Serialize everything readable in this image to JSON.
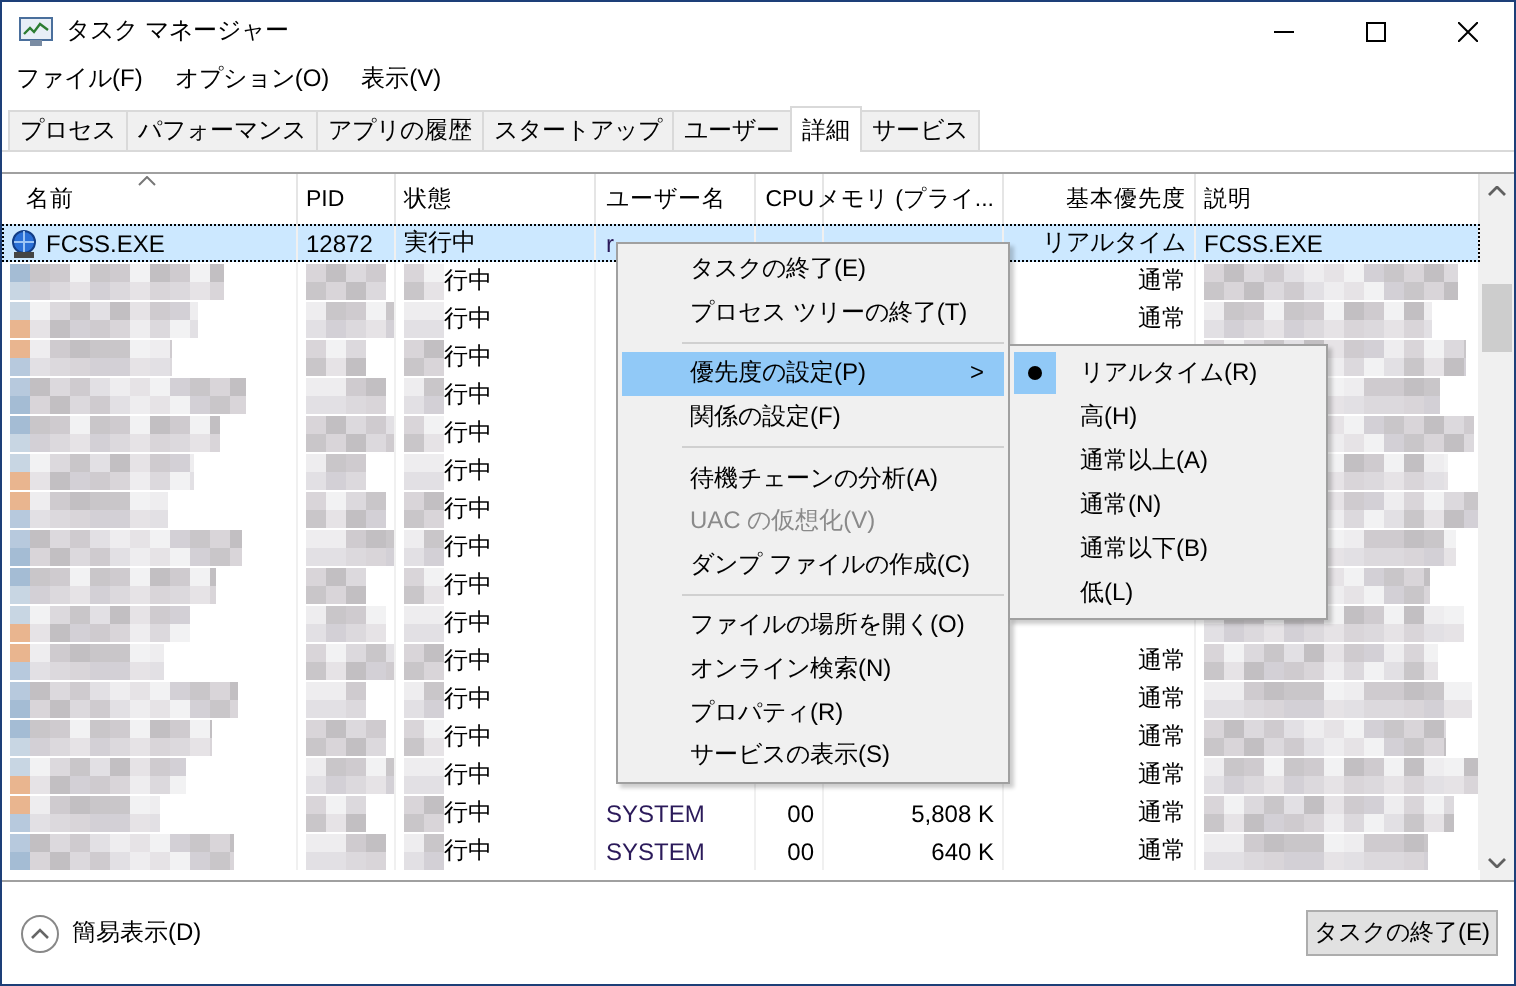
{
  "window": {
    "title": "タスク マネージャー"
  },
  "menubar": [
    "ファイル(F)",
    "オプション(O)",
    "表示(V)"
  ],
  "tabs": [
    {
      "label": "プロセス",
      "selected": false
    },
    {
      "label": "パフォーマンス",
      "selected": false
    },
    {
      "label": "アプリの履歴",
      "selected": false
    },
    {
      "label": "スタートアップ",
      "selected": false
    },
    {
      "label": "ユーザー",
      "selected": false
    },
    {
      "label": "詳細",
      "selected": true
    },
    {
      "label": "サービス",
      "selected": false
    }
  ],
  "table": {
    "columns": [
      "名前",
      "PID",
      "状態",
      "ユーザー名",
      "CPU",
      "メモリ (プライ...",
      "基本優先度",
      "説明"
    ],
    "rows": [
      {
        "name": "FCSS.EXE",
        "pid": "12872",
        "status": "実行中",
        "user": "r",
        "priority": "リアルタイム",
        "description": "FCSS.EXE",
        "selected": true
      },
      {
        "status": "行中",
        "priority": "通常",
        "selected": false
      },
      {
        "status": "行中",
        "priority": "通常",
        "selected": false
      },
      {
        "status": "行中",
        "selected": false
      },
      {
        "status": "行中",
        "selected": false
      },
      {
        "status": "行中",
        "selected": false
      },
      {
        "status": "行中",
        "selected": false
      },
      {
        "status": "行中",
        "selected": false
      },
      {
        "status": "行中",
        "selected": false
      },
      {
        "status": "行中",
        "selected": false
      },
      {
        "status": "行中",
        "selected": false
      },
      {
        "status": "行中",
        "priority": "通常",
        "selected": false
      },
      {
        "status": "行中",
        "priority": "通常",
        "selected": false
      },
      {
        "status": "行中",
        "priority": "通常",
        "selected": false
      },
      {
        "status": "行中",
        "priority": "通常",
        "selected": false
      },
      {
        "status": "行中",
        "user": "SYSTEM",
        "cpu": "00",
        "memory": "5,808 K",
        "priority": "通常",
        "selected": false
      },
      {
        "status": "行中",
        "user": "SYSTEM",
        "cpu": "00",
        "memory": "640 K",
        "priority": "通常",
        "selected": false
      }
    ]
  },
  "context_menu": [
    {
      "kind": "item",
      "label": "タスクの終了(E)",
      "disabled": false,
      "selected": false
    },
    {
      "kind": "item",
      "label": "プロセス ツリーの終了(T)",
      "disabled": false,
      "selected": false
    },
    {
      "kind": "separator"
    },
    {
      "kind": "submenu",
      "label": "優先度の設定(P)",
      "arrow": ">",
      "disabled": false,
      "selected": true
    },
    {
      "kind": "item",
      "label": "関係の設定(F)",
      "disabled": false,
      "selected": false
    },
    {
      "kind": "separator"
    },
    {
      "kind": "item",
      "label": "待機チェーンの分析(A)",
      "disabled": false,
      "selected": false
    },
    {
      "kind": "item",
      "label": "UAC の仮想化(V)",
      "disabled": true,
      "selected": false
    },
    {
      "kind": "item",
      "label": "ダンプ ファイルの作成(C)",
      "disabled": false,
      "selected": false
    },
    {
      "kind": "separator"
    },
    {
      "kind": "item",
      "label": "ファイルの場所を開く(O)",
      "disabled": false,
      "selected": false
    },
    {
      "kind": "item",
      "label": "オンライン検索(N)",
      "disabled": false,
      "selected": false
    },
    {
      "kind": "item",
      "label": "プロパティ(R)",
      "disabled": false,
      "selected": false
    },
    {
      "kind": "item",
      "label": "サービスの表示(S)",
      "disabled": false,
      "selected": false
    }
  ],
  "priority_submenu": [
    {
      "label": "リアルタイム(R)",
      "selected": true
    },
    {
      "label": "高(H)",
      "selected": false
    },
    {
      "label": "通常以上(A)",
      "selected": false
    },
    {
      "label": "通常(N)",
      "selected": false
    },
    {
      "label": "通常以下(B)",
      "selected": false
    },
    {
      "label": "低(L)",
      "selected": false
    }
  ],
  "footer": {
    "toggle": "簡易表示(D)",
    "button": "タスクの終了(E)"
  }
}
